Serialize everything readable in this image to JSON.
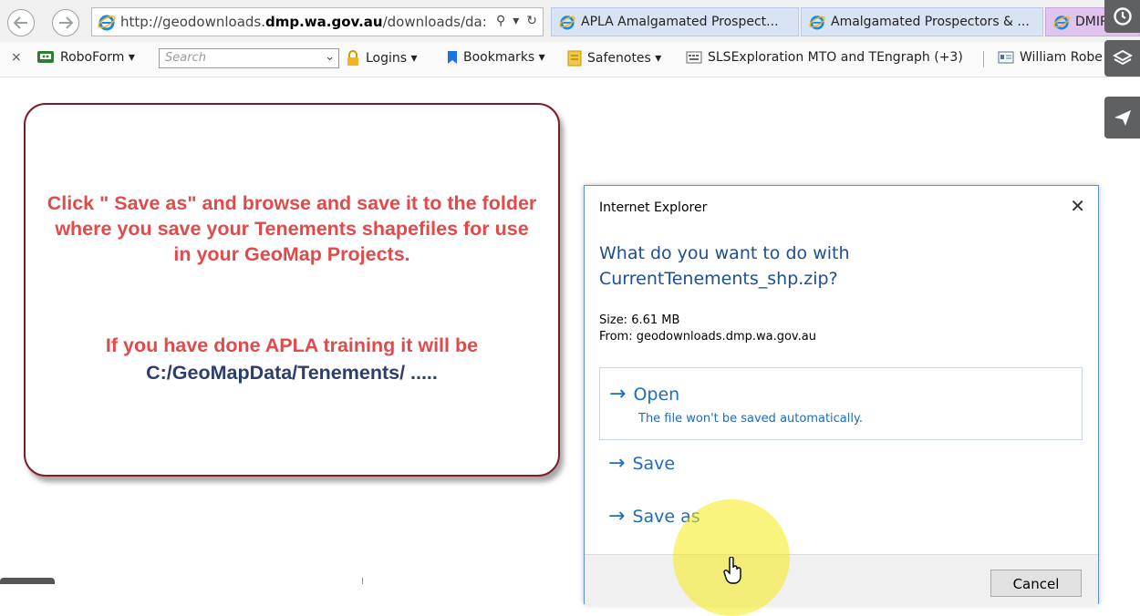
{
  "browser": {
    "url_prefix": "http://geodownloads.",
    "url_domain": "dmp.wa.gov.au",
    "url_suffix": "/downloads/da:",
    "tabs": [
      {
        "title": "APLA Amalgamated Prospect..."
      },
      {
        "title": "Amalgamated Prospectors & ..."
      },
      {
        "title": "DMIRS Da"
      }
    ]
  },
  "favbar": {
    "close": "×",
    "roboform": "RoboForm ▾",
    "search_placeholder": "Search",
    "logins": "Logins ▾",
    "bookmarks": "Bookmarks ▾",
    "safenotes": "Safenotes ▾",
    "slsexploration": "SLSExploration MTO and TEngraph (+3)",
    "william": "William Robe"
  },
  "callout": {
    "line1": "Click \" Save as\" and browse and save it to the folder where you save your Tenements shapefiles for use in your GeoMap Projects.",
    "line2": "If you have done APLA training it will be",
    "line3": "C:/GeoMapData/Tenements/ ....."
  },
  "dialog": {
    "title": "Internet Explorer",
    "close": "✕",
    "question": "What do you want to do with CurrentTenements_shp.zip?",
    "size": "Size: 6.61 MB",
    "from": "From: geodownloads.dmp.wa.gov.au",
    "open_label": "Open",
    "open_sub": "The file won't be saved automatically.",
    "save_label": "Save",
    "save_as_label": "Save as",
    "cancel_label": "Cancel"
  },
  "colors": {
    "callout_border": "#7a1e28",
    "callout_red": "#e24a4a",
    "callout_navy": "#2c3e6b",
    "dialog_blue": "#1e6bbf"
  }
}
